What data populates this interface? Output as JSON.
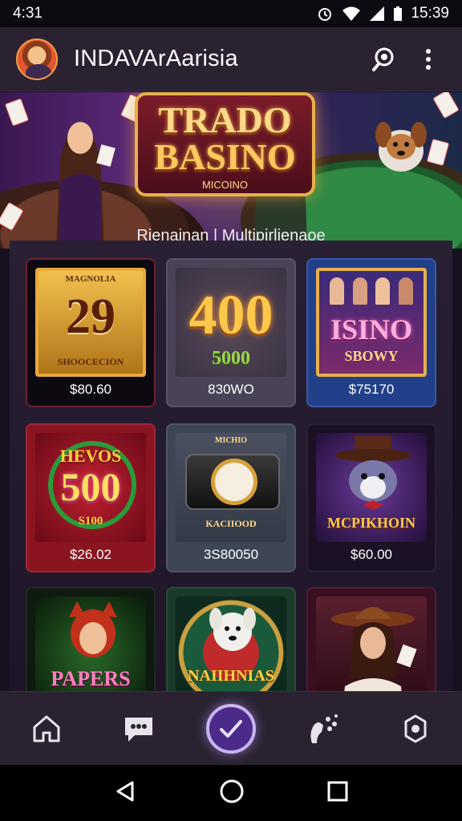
{
  "status_bar": {
    "time": "4:31",
    "clock_right": "15:39"
  },
  "app_bar": {
    "title": "INDAVArAarisia"
  },
  "banner": {
    "logo_line1": "TRADO",
    "logo_line2": "BASINO",
    "logo_line3": "MICOINO",
    "tagline": "Rienainan | Multipirlienaoe"
  },
  "tiles": [
    {
      "art_top": "MAGNOLIA",
      "art_main": "29",
      "art_sub": "SHOOCECION",
      "price": "$80.60"
    },
    {
      "art_main": "400",
      "art_sub": "5000",
      "price": "830WO"
    },
    {
      "art_main": "ISINO",
      "art_sub": "SBOWY",
      "price": "$75170"
    },
    {
      "art_top": "HEVOS",
      "art_main": "500",
      "art_sub": "S100",
      "price": "$26.02"
    },
    {
      "art_top": "MICHIO",
      "art_sub": "KACIIOOD",
      "price": "3S80050"
    },
    {
      "art_sub": "MCPIKHOIN",
      "price": "$60.00"
    },
    {
      "art_main": "PAPERS",
      "price": ""
    },
    {
      "art_main": "NAIIHNIAS",
      "price": ""
    },
    {
      "price": ""
    }
  ],
  "bottom_nav": {
    "items": [
      "home-icon",
      "chat-icon",
      "check-icon",
      "gestures-icon",
      "settings-icon"
    ],
    "accent": "#4b2a8a"
  },
  "colors": {
    "gold": "#e7b04a",
    "background": "#17101f",
    "bar": "#2a2230"
  }
}
